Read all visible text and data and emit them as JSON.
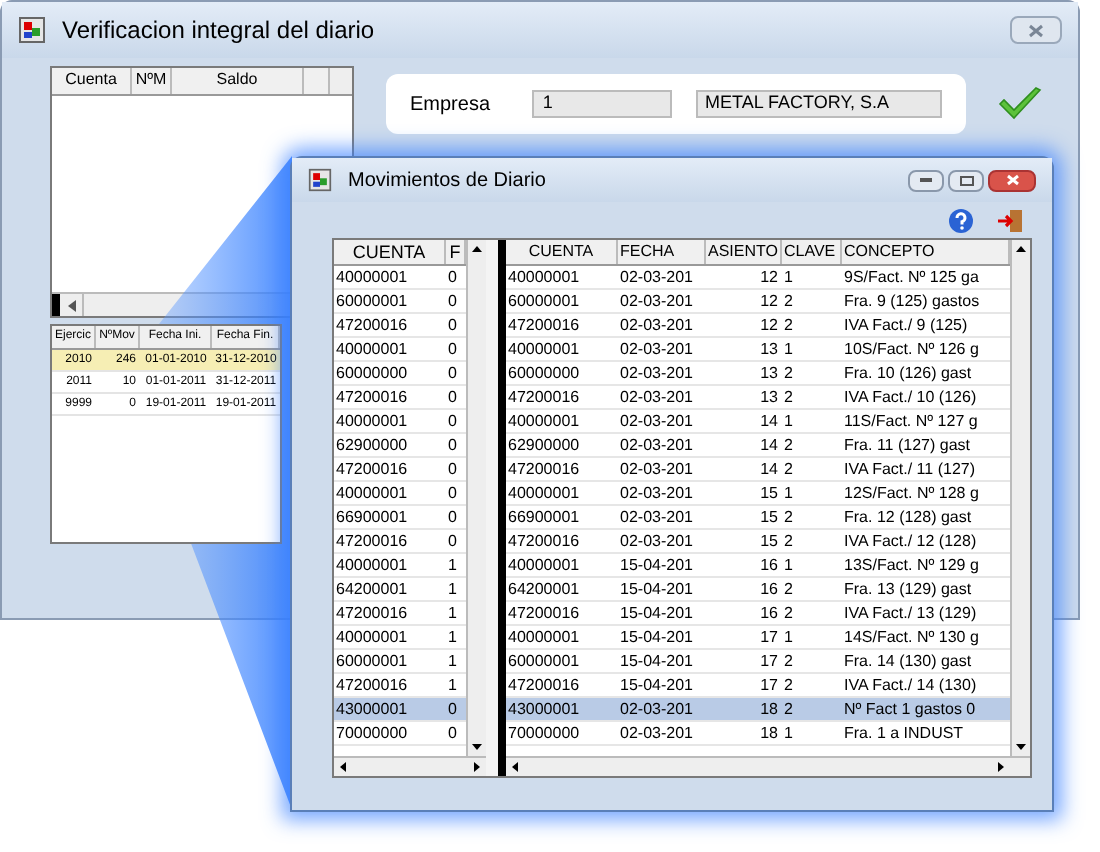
{
  "window": {
    "title": "Verificacion integral del diario"
  },
  "accounts_table": {
    "columns": [
      "Cuenta",
      "NºM",
      "Saldo"
    ]
  },
  "years_table": {
    "columns": [
      "Ejercic",
      "NºMov",
      "Fecha Ini.",
      "Fecha Fin."
    ],
    "rows": [
      {
        "cells": [
          "2010",
          "246",
          "01-01-2010",
          "31-12-2010"
        ],
        "selected": true
      },
      {
        "cells": [
          "2011",
          "10",
          "01-01-2011",
          "31-12-2011"
        ],
        "selected": false
      },
      {
        "cells": [
          "9999",
          "0",
          "19-01-2011",
          "19-01-2011"
        ],
        "selected": false
      }
    ]
  },
  "empresa": {
    "label": "Empresa",
    "code": "1",
    "name": "METAL FACTORY, S.A"
  },
  "detail_window": {
    "title": "Movimientos de Diario",
    "left_columns": [
      "CUENTA",
      "F"
    ],
    "right_columns": [
      "CUENTA",
      "FECHA",
      "ASIENTO",
      "CLAVE",
      "CONCEPTO"
    ],
    "rows": [
      {
        "cells": [
          "40000001",
          "0",
          "40000001",
          "02-03-201",
          "12",
          "1",
          "9S/Fact. Nº 125 ga"
        ],
        "selected": false
      },
      {
        "cells": [
          "60000001",
          "0",
          "60000001",
          "02-03-201",
          "12",
          "2",
          "Fra. 9 (125) gastos"
        ],
        "selected": false
      },
      {
        "cells": [
          "47200016",
          "0",
          "47200016",
          "02-03-201",
          "12",
          "2",
          "IVA Fact./ 9 (125)"
        ],
        "selected": false
      },
      {
        "cells": [
          "40000001",
          "0",
          "40000001",
          "02-03-201",
          "13",
          "1",
          "10S/Fact. Nº 126 g"
        ],
        "selected": false
      },
      {
        "cells": [
          "60000000",
          "0",
          "60000000",
          "02-03-201",
          "13",
          "2",
          "Fra. 10 (126) gast"
        ],
        "selected": false
      },
      {
        "cells": [
          "47200016",
          "0",
          "47200016",
          "02-03-201",
          "13",
          "2",
          "IVA Fact./ 10 (126)"
        ],
        "selected": false
      },
      {
        "cells": [
          "40000001",
          "0",
          "40000001",
          "02-03-201",
          "14",
          "1",
          "11S/Fact. Nº 127 g"
        ],
        "selected": false
      },
      {
        "cells": [
          "62900000",
          "0",
          "62900000",
          "02-03-201",
          "14",
          "2",
          "Fra. 11 (127) gast"
        ],
        "selected": false
      },
      {
        "cells": [
          "47200016",
          "0",
          "47200016",
          "02-03-201",
          "14",
          "2",
          "IVA Fact./ 11 (127)"
        ],
        "selected": false
      },
      {
        "cells": [
          "40000001",
          "0",
          "40000001",
          "02-03-201",
          "15",
          "1",
          "12S/Fact. Nº 128 g"
        ],
        "selected": false
      },
      {
        "cells": [
          "66900001",
          "0",
          "66900001",
          "02-03-201",
          "15",
          "2",
          "Fra. 12 (128) gast"
        ],
        "selected": false
      },
      {
        "cells": [
          "47200016",
          "0",
          "47200016",
          "02-03-201",
          "15",
          "2",
          "IVA Fact./ 12 (128)"
        ],
        "selected": false
      },
      {
        "cells": [
          "40000001",
          "1",
          "40000001",
          "15-04-201",
          "16",
          "1",
          "13S/Fact. Nº 129 g"
        ],
        "selected": false
      },
      {
        "cells": [
          "64200001",
          "1",
          "64200001",
          "15-04-201",
          "16",
          "2",
          "Fra. 13 (129) gast"
        ],
        "selected": false
      },
      {
        "cells": [
          "47200016",
          "1",
          "47200016",
          "15-04-201",
          "16",
          "2",
          "IVA Fact./ 13 (129)"
        ],
        "selected": false
      },
      {
        "cells": [
          "40000001",
          "1",
          "40000001",
          "15-04-201",
          "17",
          "1",
          "14S/Fact. Nº 130 g"
        ],
        "selected": false
      },
      {
        "cells": [
          "60000001",
          "1",
          "60000001",
          "15-04-201",
          "17",
          "2",
          "Fra. 14 (130) gast"
        ],
        "selected": false
      },
      {
        "cells": [
          "47200016",
          "1",
          "47200016",
          "15-04-201",
          "17",
          "2",
          "IVA Fact./ 14 (130)"
        ],
        "selected": false
      },
      {
        "cells": [
          "43000001",
          "0",
          "43000001",
          "02-03-201",
          "18",
          "2",
          "Nº Fact 1 gastos 0"
        ],
        "selected": true
      },
      {
        "cells": [
          "70000000",
          "0",
          "70000000",
          "02-03-201",
          "18",
          "1",
          "Fra. 1 a INDUST"
        ],
        "selected": false
      }
    ]
  }
}
